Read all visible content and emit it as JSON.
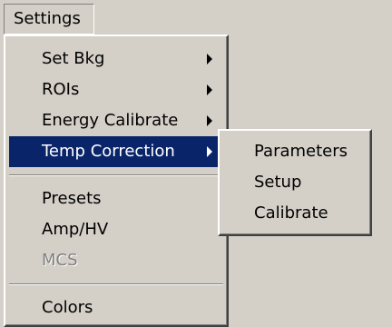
{
  "menubar": {
    "settings_label": "Settings"
  },
  "settings_menu": {
    "items": [
      {
        "label": "Set Bkg",
        "submenu": true,
        "state": "normal"
      },
      {
        "label": "ROIs",
        "submenu": true,
        "state": "normal"
      },
      {
        "label": "Energy Calibrate",
        "submenu": true,
        "state": "normal"
      },
      {
        "label": "Temp Correction",
        "submenu": true,
        "state": "highlighted"
      },
      {
        "label": "Presets",
        "submenu": false,
        "state": "normal"
      },
      {
        "label": "Amp/HV",
        "submenu": false,
        "state": "normal"
      },
      {
        "label": "MCS",
        "submenu": false,
        "state": "disabled"
      },
      {
        "label": "Colors",
        "submenu": false,
        "state": "normal"
      }
    ]
  },
  "temp_correction_submenu": {
    "items": [
      {
        "label": "Parameters"
      },
      {
        "label": "Setup"
      },
      {
        "label": "Calibrate"
      }
    ]
  },
  "colors": {
    "face": "#d4d0c8",
    "highlight": "#0a246a",
    "highlight_text": "#ffffff",
    "disabled_text": "#808080"
  }
}
